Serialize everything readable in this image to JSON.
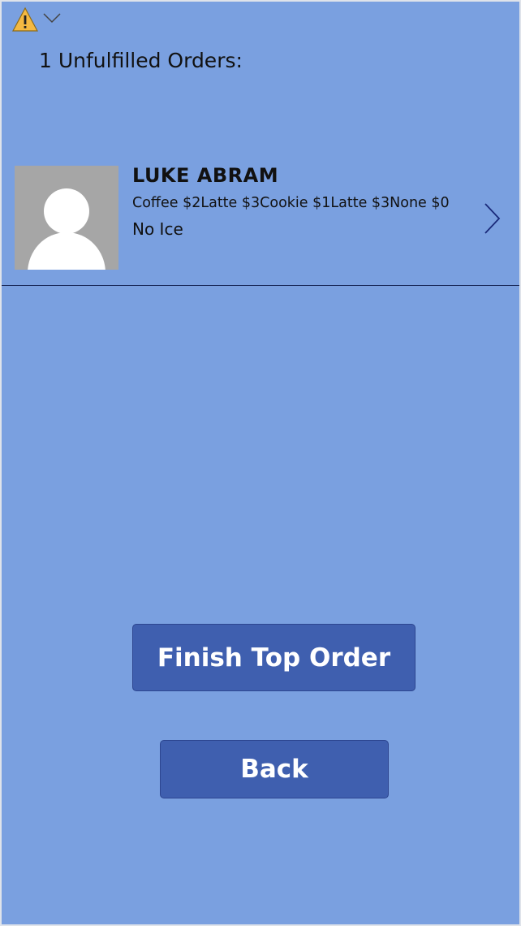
{
  "header": {
    "warning_icon": "warning-icon",
    "dropdown_icon": "chevron-down-icon",
    "title": "1 Unfulfilled Orders:"
  },
  "orders": [
    {
      "name": "LUKE ABRAM",
      "items": "Coffee $2Latte $3Cookie $1Latte $3None $0",
      "note": "No Ice",
      "avatar_icon": "person-icon",
      "nav_icon": "chevron-right-icon"
    }
  ],
  "buttons": {
    "finish_label": "Finish Top Order",
    "back_label": "Back"
  },
  "colors": {
    "background": "#7aa0e0",
    "button": "#3f5faf",
    "warning": "#f4b942",
    "divider": "#1a2a5a"
  }
}
